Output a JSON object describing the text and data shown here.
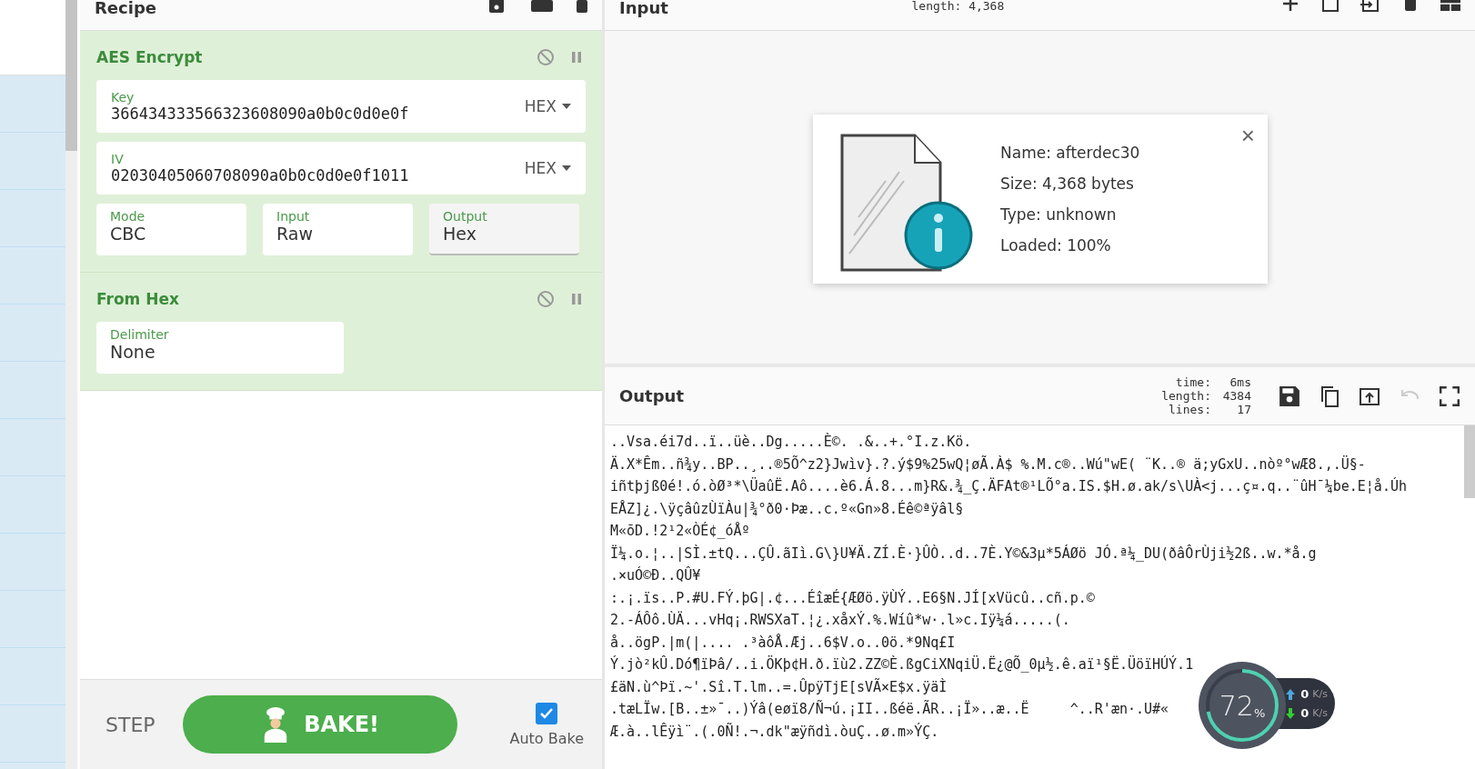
{
  "recipe": {
    "title": "Recipe",
    "operations": [
      {
        "name": "AES Encrypt",
        "args": [
          {
            "kind": "hex",
            "label": "Key",
            "value": "366434333566323608090a0b0c0d0e0f",
            "format": "HEX"
          },
          {
            "kind": "hex",
            "label": "IV",
            "value": "02030405060708090a0b0c0d0e0f1011",
            "format": "HEX"
          },
          {
            "kind": "row",
            "fields": [
              {
                "label": "Mode",
                "value": "CBC",
                "focused": false
              },
              {
                "label": "Input",
                "value": "Raw",
                "focused": false
              },
              {
                "label": "Output",
                "value": "Hex",
                "focused": true
              }
            ]
          }
        ]
      },
      {
        "name": "From Hex",
        "args": [
          {
            "kind": "row",
            "fields": [
              {
                "label": "Delimiter",
                "value": "None",
                "focused": false
              }
            ]
          }
        ]
      }
    ]
  },
  "controls": {
    "step": "STEP",
    "bake": "BAKE!",
    "auto_bake": {
      "label": "Auto Bake",
      "checked": true
    }
  },
  "input": {
    "title": "Input",
    "length": "length: 4,368",
    "file": {
      "lines": [
        "Name: afterdec30",
        "Size: 4,368 bytes",
        "Type: unknown",
        "Loaded: 100%"
      ],
      "close": "×"
    }
  },
  "output": {
    "title": "Output",
    "stats": [
      {
        "label": "time:",
        "value": "6ms"
      },
      {
        "label": "length:",
        "value": "4384"
      },
      {
        "label": "lines:",
        "value": "17"
      }
    ],
    "lines": [
      "..Vsa.éi7d..ï..üè..Dg.....È©. .&..+.°I.z.Kö.",
      "Ä.X*Êm..ñ¾y..BP..¸..®5Õ^z2}Jwìv}.?.ý$9%25wQ¦øÃ.À$ %.M.c®..Wú\"wE( ¨K..® ä;yGxU..nòº°wÆ8.,.Ü§-",
      "iñtþjß0é!.ó.òØ³*\\ÜaûË.Aô....è6.Á.8...m}R&.¾_Ç.ÄFAt®¹LÕ°a.IS.$H.ø.ak/s\\UÀ<j...ç¤.q..¨ûH¯¼be.E¦å.Úh",
      "EÅZ]¿.\\ÿçâûzÙïÀu|¾°ð0·Þæ..c.º«Gn»8.Éê©ªÿâl§",
      "M«õD.!2¹2«ÒÉ¢_óÅº",
      "Ï¼.o.¦..|SÌ.±tQ...ÇÛ.ãIì.G\\}U¥Ä.ZÍ.È·}ÛÒ..d..7È.Y©&3µ*5ÁØö JÓ.ª¼_DU(ðâÔrÙji½2ß..w.*å.g",
      ".×uÓ©Ð..QÛ¥",
      ":.¡.ïs..P.#U.FÝ.þG|.¢...ÉîæÉ{ÆØö.ÿÙÝ..E6§N.JÍ[xVücû..cñ.p.©",
      "2.-ÁÔô.ÙÄ...vHq¡.RWSXaT.¦¿.xåxÝ.%.Wíû*w·.l»c.Iÿ¼á.....(.",
      "å..ögP.|m(|.... .³àôÅ.Æj..6$V.o..0ö.*9Nq£I",
      "Ý.jò²kÛ.Dó¶ïÞâ/..i.ÖKþ¢H.ð.ïù2.ZZ©È.ßgCiXNqiÜ.Ë¿@Õ_0µ½.ê.aï¹§Ë.ÜöïHÚÝ.1",
      "£äN.ù^Þï.~'.Sî.T.lm..=.ÛpÿTjE[sVÃ×E$x.ÿäÌ",
      ".tæLÏw.[B..±»¯..)Ýâ(eøï8/Ñ¬ú.¡II..ßéë.ÃR..¡Ï»..æ..Ë     ^..R'æn·.U#«",
      "Æ.à..lÊÿì¨.(.0Ñ!.¬.dk\"æÿñdì.òuÇ..ø.m»ÝÇ."
    ]
  },
  "net_monitor": {
    "percent": "72",
    "unit": "%",
    "level": 0.72,
    "rates": [
      {
        "kind": "up",
        "value": "0",
        "unit": "K/s"
      },
      {
        "kind": "down",
        "value": "0",
        "unit": "K/s"
      }
    ]
  }
}
